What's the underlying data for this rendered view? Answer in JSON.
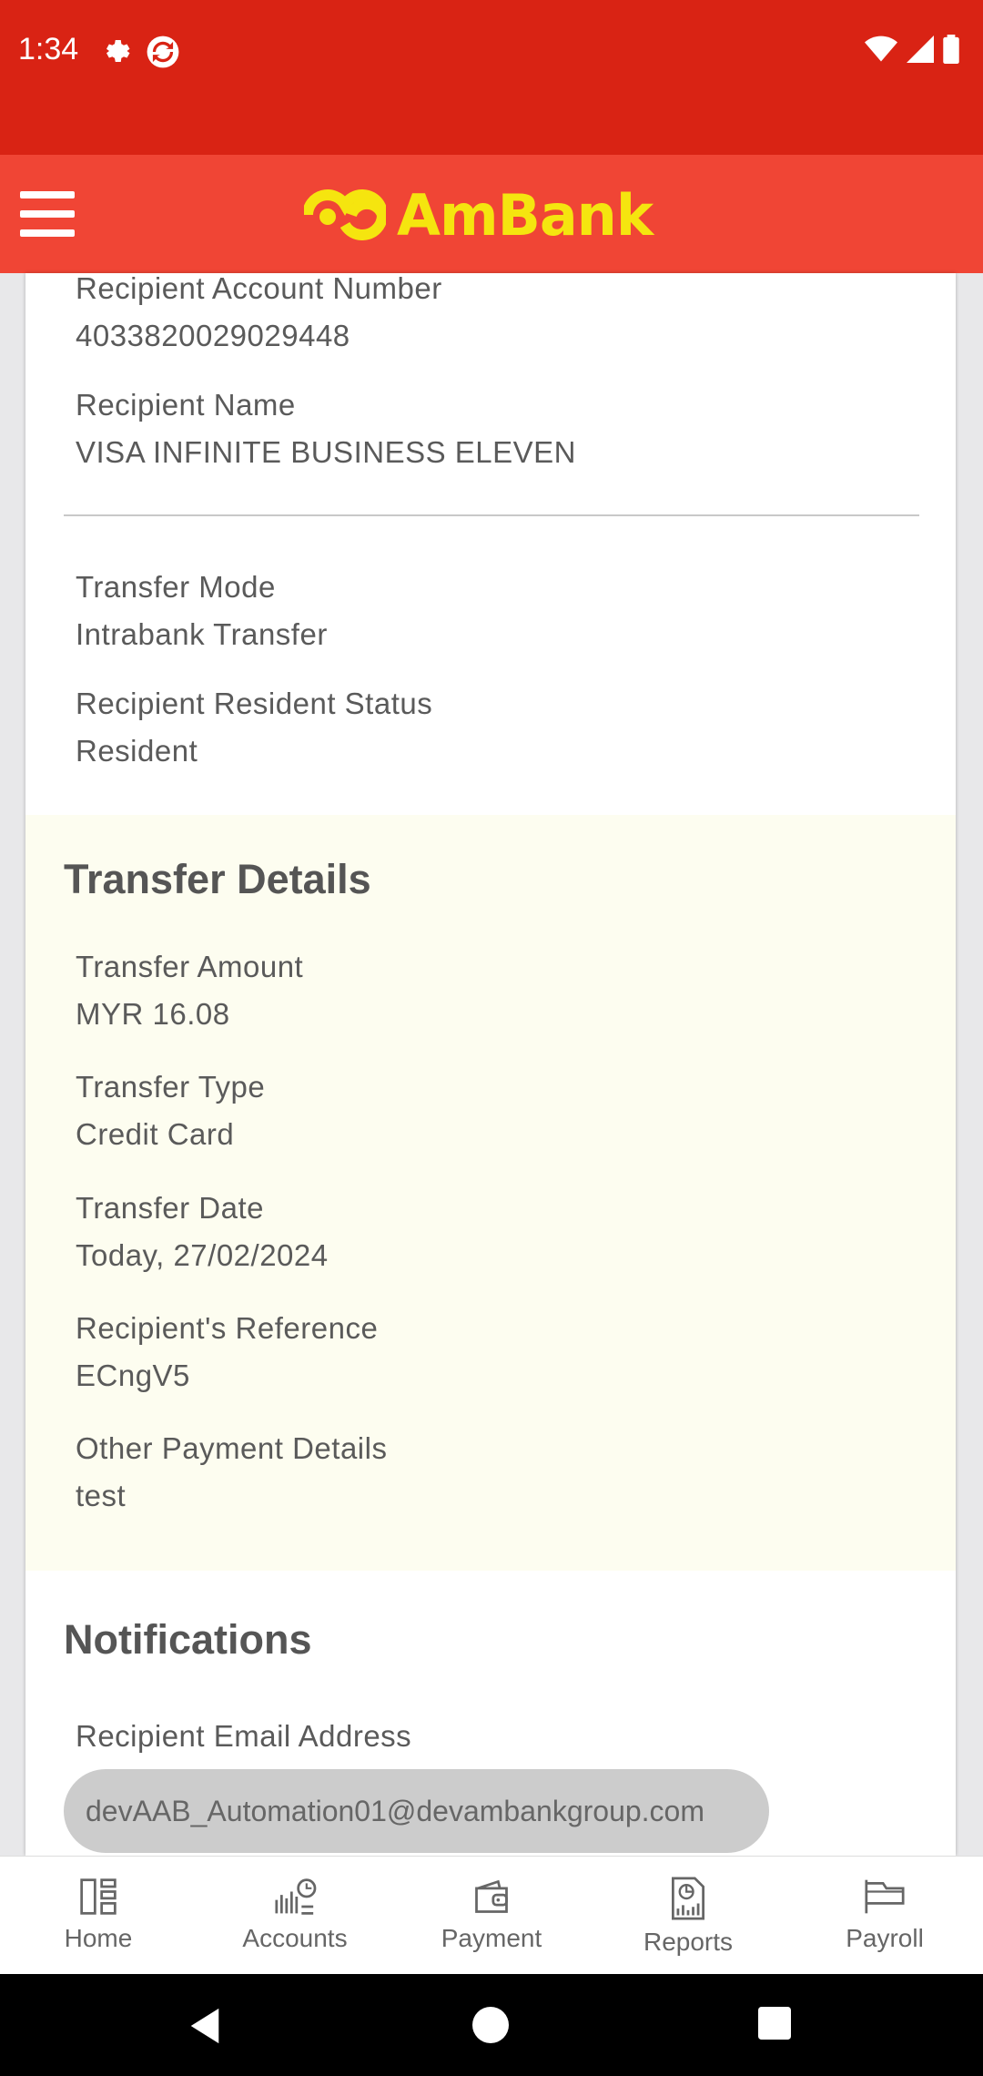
{
  "status_bar": {
    "time": "1:34"
  },
  "header": {
    "brand": "AmBank"
  },
  "recipient": {
    "account_number_label": "Recipient Account Number",
    "account_number_value": "4033820029029448",
    "name_label": "Recipient Name",
    "name_value": "VISA INFINITE BUSINESS ELEVEN",
    "mode_label": "Transfer Mode",
    "mode_value": "Intrabank Transfer",
    "resident_label": "Recipient Resident Status",
    "resident_value": "Resident"
  },
  "transfer_details": {
    "title": "Transfer Details",
    "amount_label": "Transfer Amount",
    "amount_value": "MYR 16.08",
    "type_label": "Transfer Type",
    "type_value": "Credit Card",
    "date_label": "Transfer Date",
    "date_value": "Today, 27/02/2024",
    "reference_label": "Recipient's Reference",
    "reference_value": "ECngV5",
    "other_label": "Other Payment Details",
    "other_value": "test"
  },
  "notifications": {
    "title": "Notifications",
    "email_label": "Recipient Email Address",
    "email_value": "devAAB_Automation01@devambankgroup.com"
  },
  "tabs": [
    {
      "label": "Home",
      "icon": "home-icon"
    },
    {
      "label": "Accounts",
      "icon": "accounts-icon"
    },
    {
      "label": "Payment",
      "icon": "wallet-icon"
    },
    {
      "label": "Reports",
      "icon": "reports-icon"
    },
    {
      "label": "Payroll",
      "icon": "payroll-icon"
    }
  ],
  "colors": {
    "status_bar": "#d92314",
    "header": "#f04535",
    "brand_yellow": "#f5e50f",
    "details_bg": "#fdfdf0"
  }
}
